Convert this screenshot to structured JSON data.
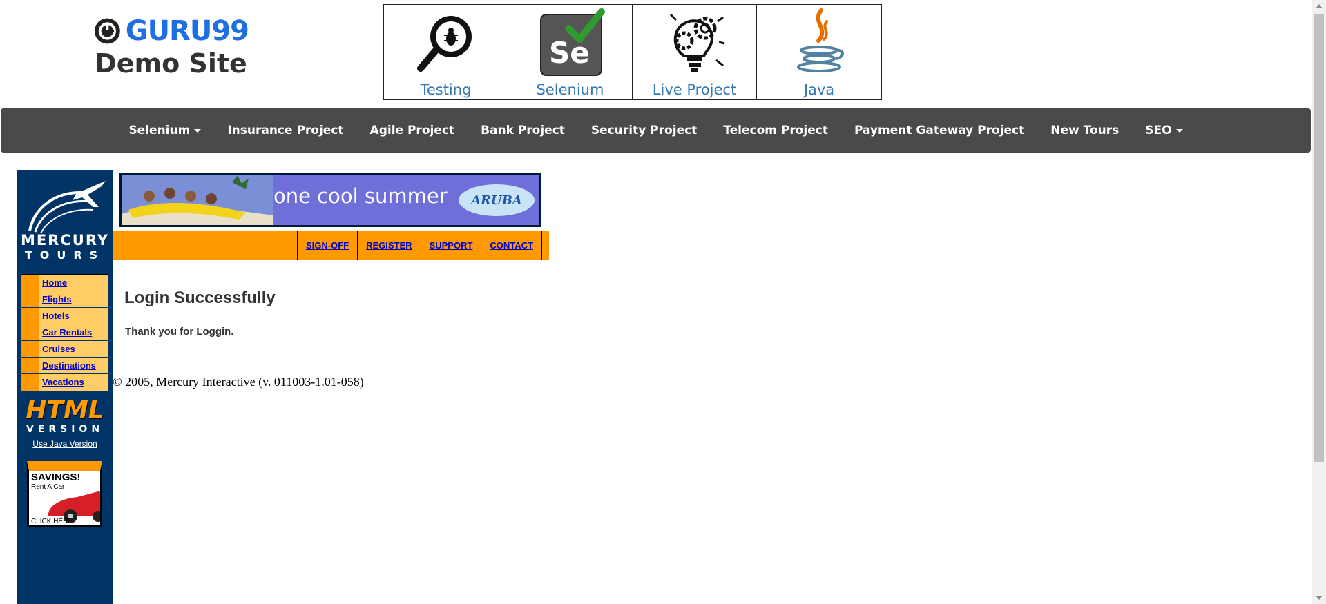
{
  "header": {
    "brand": "GURU99",
    "subtitle": "Demo Site",
    "topics": [
      {
        "label": "Testing",
        "icon": "magnifier-bug-icon"
      },
      {
        "label": "Selenium",
        "icon": "selenium-logo-icon"
      },
      {
        "label": "Live Project",
        "icon": "lightbulb-gear-icon"
      },
      {
        "label": "Java",
        "icon": "java-coffee-icon"
      }
    ]
  },
  "nav": {
    "items": [
      {
        "label": "Selenium",
        "dropdown": true
      },
      {
        "label": "Insurance Project"
      },
      {
        "label": "Agile Project"
      },
      {
        "label": "Bank Project"
      },
      {
        "label": "Security Project"
      },
      {
        "label": "Telecom Project"
      },
      {
        "label": "Payment Gateway Project"
      },
      {
        "label": "New Tours"
      },
      {
        "label": "SEO",
        "dropdown": true
      }
    ]
  },
  "mercury": {
    "logo_line1": "MERCURY",
    "logo_line2": "TOURS",
    "sidebar_links": [
      "Home",
      "Flights",
      "Hotels",
      "Car Rentals",
      "Cruises",
      "Destinations",
      "Vacations"
    ],
    "html_version_line1": "HTML",
    "html_version_line2": "VERSION",
    "java_version_link": "Use Java Version",
    "ad_title": "SAVINGS!",
    "ad_subtitle": "Rent A Car",
    "ad_cta": "CLICK HERE",
    "banner_text": "one cool summer",
    "banner_brand": "ARUBA",
    "top_links": [
      "SIGN-OFF",
      "REGISTER",
      "SUPPORT",
      "CONTACT"
    ]
  },
  "content": {
    "heading": "Login Successfully",
    "message": "Thank you for Loggin.",
    "footer": "© 2005, Mercury Interactive (v. 011003-1.01-058)"
  },
  "colors": {
    "brand_blue": "#1f6fe0",
    "nav_bg": "#4a4a4a",
    "mercury_navy": "#003366",
    "mercury_orange": "#ff9900",
    "link_blue": "#0000cc"
  }
}
